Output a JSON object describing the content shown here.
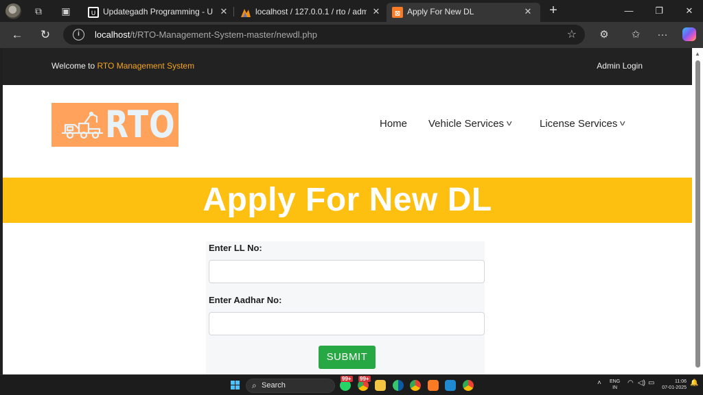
{
  "browser": {
    "tabs": [
      {
        "title": "Updategadh Programming - Upd",
        "favicon": "updategadh-favicon"
      },
      {
        "title": "localhost / 127.0.0.1 / rto / admin",
        "favicon": "phpmyadmin-favicon"
      },
      {
        "title": "Apply For New DL",
        "favicon": "xampp-favicon",
        "active": true
      }
    ],
    "url_host": "localhost",
    "url_path": "/t/RTO-Management-System-master/newdl.php"
  },
  "site": {
    "welcome_prefix": "Welcome to ",
    "brand_name": "RTO Management System",
    "admin_login": "Admin Login",
    "logo_text": "RTO",
    "nav": {
      "home": "Home",
      "vehicle_services": "Vehicle Services",
      "license_services": "License Services"
    },
    "banner_title": "Apply For New DL",
    "form": {
      "ll_label": "Enter LL No:",
      "ll_value": "",
      "aadhar_label": "Enter Aadhar No:",
      "aadhar_value": "",
      "submit_label": "SUBMIT"
    }
  },
  "taskbar": {
    "search_label": "Search",
    "badge_whatsapp": "99+",
    "badge_chrome": "99+",
    "lang_line1": "ENG",
    "lang_line2": "IN",
    "time": "11:06",
    "date": "07-01-2025"
  },
  "colors": {
    "accent_brand": "#f5a623",
    "banner_bg": "#fdc010",
    "logo_bg": "#ffa35c",
    "submit_bg": "#28a745",
    "topbar_bg": "#222222"
  }
}
